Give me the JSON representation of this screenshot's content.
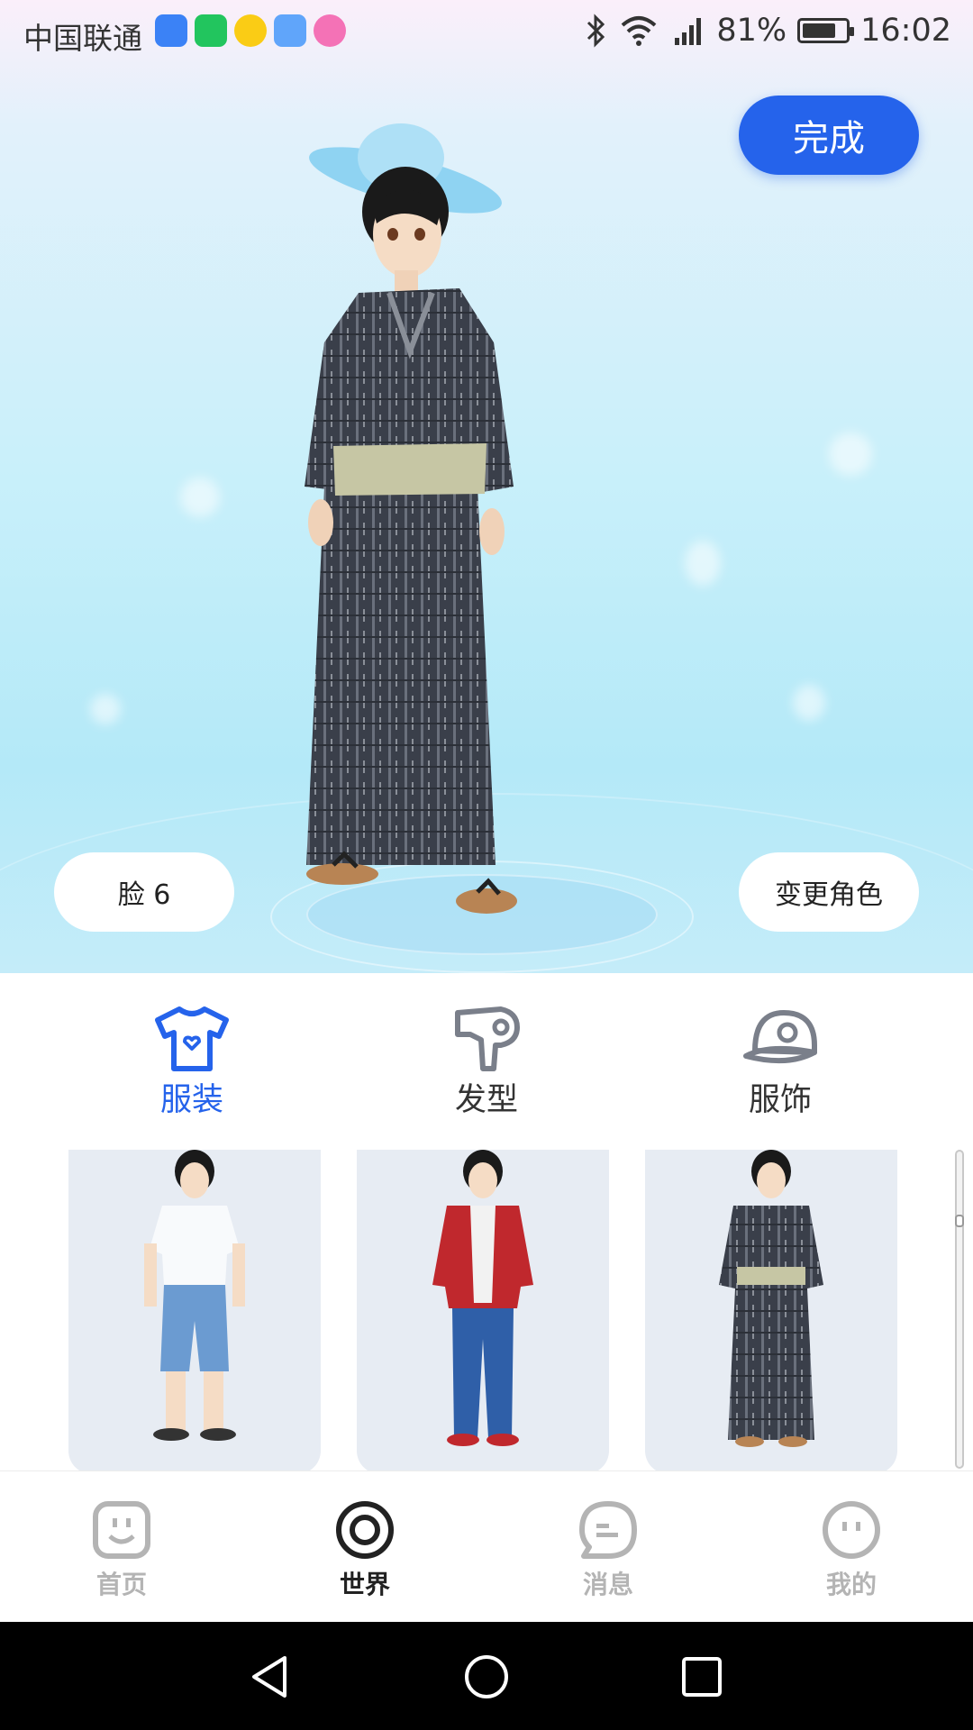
{
  "status_bar": {
    "carrier": "中国联通",
    "battery": "81%",
    "time": "16:02",
    "apps": [
      "shield-app-icon",
      "qu-app-icon",
      "play-app-icon",
      "k-app-icon",
      "flower-app-icon"
    ]
  },
  "header": {
    "done_label": "完成"
  },
  "scene": {
    "face_label": "脸 6",
    "change_role_label": "变更角色"
  },
  "tabs": [
    {
      "label": "服装",
      "icon": "tshirt-icon",
      "active": true
    },
    {
      "label": "发型",
      "icon": "hair-dryer-icon",
      "active": false
    },
    {
      "label": "服饰",
      "icon": "cap-icon",
      "active": false
    }
  ],
  "outfits": [
    {
      "name": "tshirt-shorts-outfit"
    },
    {
      "name": "red-jacket-outfit"
    },
    {
      "name": "yukata-outfit"
    }
  ],
  "bottom_nav": [
    {
      "label": "首页",
      "icon": "home-icon",
      "active": false
    },
    {
      "label": "世界",
      "icon": "world-icon",
      "active": true
    },
    {
      "label": "消息",
      "icon": "message-icon",
      "active": false
    },
    {
      "label": "我的",
      "icon": "profile-icon",
      "active": false
    }
  ],
  "colors": {
    "accent": "#2563eb",
    "inactive": "#b4b4b4"
  }
}
